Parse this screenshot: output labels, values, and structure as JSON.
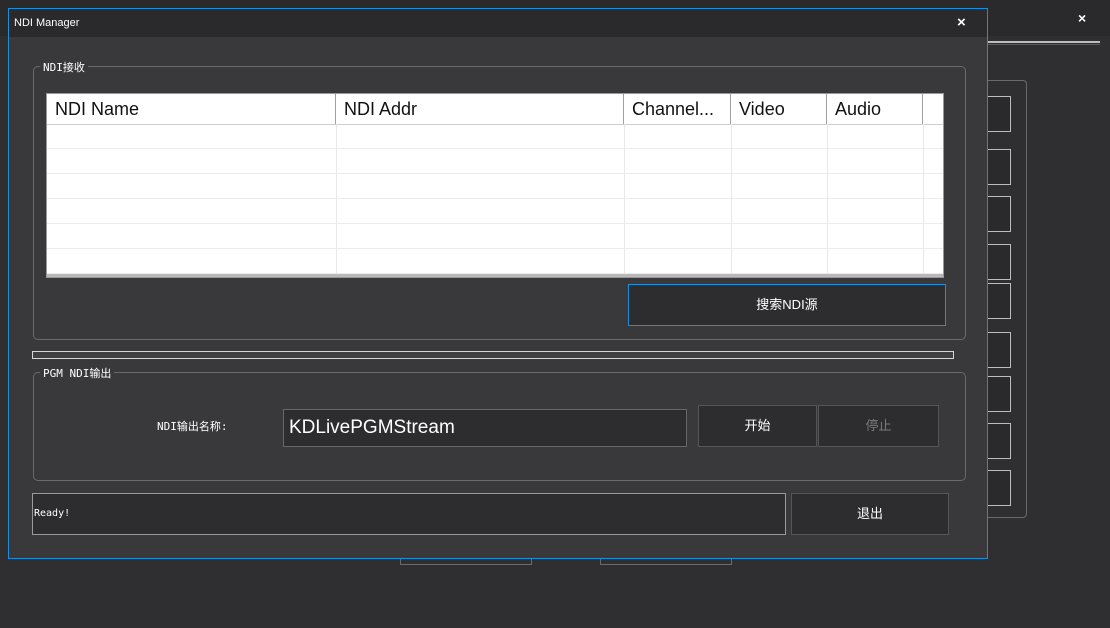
{
  "window": {
    "title": "NDI Manager",
    "close_glyph": "×"
  },
  "background": {
    "close_glyph": "×"
  },
  "receive": {
    "group_label": "NDI接收",
    "columns": [
      "NDI Name",
      "NDI Addr",
      "Channel...",
      "Video",
      "Audio"
    ],
    "rows": [],
    "search_button": "搜索NDI源"
  },
  "output": {
    "group_label": "PGM NDI输出",
    "name_label": "NDI输出名称:",
    "name_value": "KDLivePGMStream",
    "start_button": "开始",
    "stop_button": "停止"
  },
  "status": {
    "text": "Ready!"
  },
  "exit_button": "退出",
  "colors": {
    "accent": "#1e8fd6",
    "background": "#39393c",
    "titlebar": "#2a2a2d"
  }
}
